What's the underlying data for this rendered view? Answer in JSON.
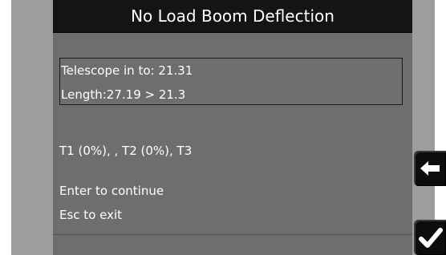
{
  "header": {
    "title": "No Load Boom Deflection"
  },
  "info_box": {
    "telescope_text": "Telescope in to: 21.31",
    "length_text": "Length:27.19 > 21.3"
  },
  "tension_text": "T1 (0%), , T2 (0%), T3",
  "instructions": {
    "continue_text": "Enter to continue",
    "exit_text": "Esc to exit"
  },
  "buttons": {
    "back_icon": "left-arrow-icon",
    "confirm_icon": "checkmark-icon"
  },
  "colors": {
    "title_bar": "#141414",
    "screen_bg": "#6e6e6e",
    "bezel": "#9d9d9d",
    "text": "#ffffff"
  }
}
